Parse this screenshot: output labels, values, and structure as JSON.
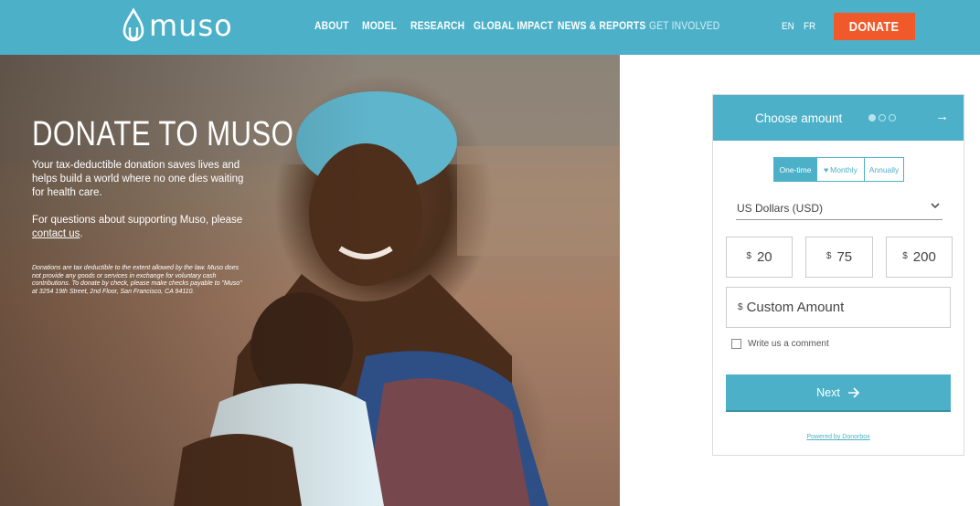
{
  "header": {
    "logo_text": "muso",
    "nav": [
      {
        "label": "ABOUT"
      },
      {
        "label": "MODEL"
      },
      {
        "label": "RESEARCH"
      },
      {
        "label": "GLOBAL IMPACT"
      },
      {
        "label": "NEWS & REPORTS"
      },
      {
        "label": "GET INVOLVED"
      }
    ],
    "lang_en": "EN",
    "lang_fr": "FR",
    "donate_label": "DONATE"
  },
  "hero": {
    "title": "DONATE TO MUSO",
    "lead": "Your tax-deductible donation saves lives and helps build a world where no one dies waiting for health care.",
    "question_prefix": "For questions about supporting Muso, please ",
    "contact_link": "contact us",
    "question_suffix": ".",
    "fine_print": "Donations are tax deductible to the extent allowed by the law. Muso does not provide any goods or services in exchange for voluntary cash contributions. To donate by check, please make checks payable to \"Muso\" at 3254 19th Street, 2nd Floor, San Francisco, CA 94110."
  },
  "widget": {
    "title": "Choose amount",
    "step_current": 1,
    "step_total": 3,
    "frequency": {
      "one_time": "One-time",
      "monthly": "Monthly",
      "annual": "Annually",
      "selected": "One-time"
    },
    "currency": "US Dollars (USD)",
    "currency_symbol": "$",
    "amounts": [
      "20",
      "75",
      "200"
    ],
    "custom_placeholder": "Custom Amount",
    "comment_label": "Write us a comment",
    "next_label": "Next",
    "powered_by": "Powered by Donorbox"
  },
  "colors": {
    "brand": "#4cb1c8",
    "donate": "#f05a2a"
  }
}
